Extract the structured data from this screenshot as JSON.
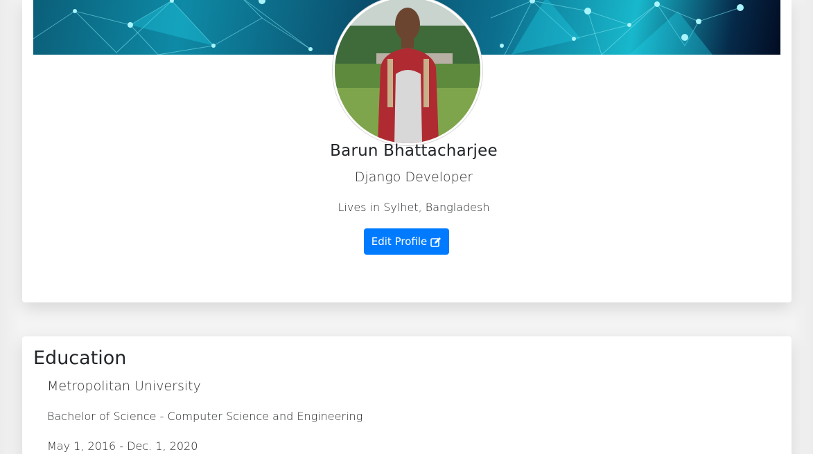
{
  "profile": {
    "name": "Barun Bhattacharjee",
    "title": "Django Developer",
    "location": "Lives in Sylhet, Bangladesh",
    "edit_button_label": "Edit Profile",
    "edit_icon": "edit-icon"
  },
  "education": {
    "heading": "Education",
    "entries": [
      {
        "school": "Metropolitan University",
        "degree": "Bachelor of Science - Computer Science and Engineering",
        "dates": "May 1, 2016 - Dec. 1, 2020"
      }
    ]
  },
  "colors": {
    "accent": "#007bff",
    "background": "#f4f4f4",
    "card": "#ffffff",
    "text": "#212529"
  }
}
